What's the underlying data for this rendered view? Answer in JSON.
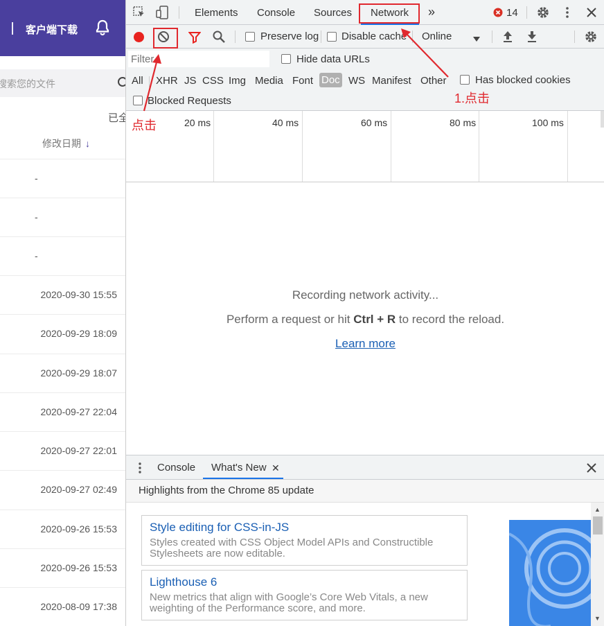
{
  "left_page": {
    "download_label": "客户端下载",
    "search_placeholder": "搜索您的文件",
    "already_label": "已全",
    "column_header": "修改日期",
    "sort_icon": "arrow-down-icon",
    "rows": [
      "-",
      "-",
      "-",
      "2020-09-30 15:55",
      "2020-09-29 18:09",
      "2020-09-29 18:07",
      "2020-09-27 22:04",
      "2020-09-27 22:01",
      "2020-09-27 02:49",
      "2020-09-26 15:53",
      "2020-09-26 15:53",
      "2020-08-09 17:38"
    ],
    "colors": {
      "header_bg": "#4a3f9e"
    }
  },
  "devtools": {
    "tabs": [
      "Elements",
      "Console",
      "Sources",
      "Network"
    ],
    "more_tabs": "»",
    "error_count": "14",
    "toolbar": {
      "preserve_log": "Preserve log",
      "disable_cache": "Disable cache",
      "throttling": "Online"
    },
    "filter": {
      "placeholder": "Filter",
      "hide_data_urls": "Hide data URLs",
      "types": [
        "All",
        "XHR",
        "JS",
        "CSS",
        "Img",
        "Media",
        "Font",
        "Doc",
        "WS",
        "Manifest",
        "Other"
      ],
      "active_type": "Doc",
      "has_blocked_cookies": "Has blocked cookies",
      "blocked_requests": "Blocked Requests"
    },
    "timeline_ticks": [
      "20 ms",
      "40 ms",
      "60 ms",
      "80 ms",
      "100 ms"
    ],
    "empty_state": {
      "line1": "Recording network activity...",
      "line2_before": "Perform a request or hit ",
      "line2_keys": "Ctrl + R",
      "line2_after": " to record the reload.",
      "learn_more": "Learn more"
    },
    "drawer": {
      "tabs": [
        "Console",
        "What's New"
      ],
      "heading": "Highlights from the Chrome 85 update",
      "cards": [
        {
          "title": "Style editing for CSS-in-JS",
          "desc": "Styles created with CSS Object Model APIs and Constructible Stylesheets are now editable."
        },
        {
          "title": "Lighthouse 6",
          "desc": "New metrics that align with Google’s Core Web Vitals, a new weighting of the Performance score, and more."
        }
      ]
    }
  },
  "annotations": {
    "step1": "1.点击",
    "click": "点击",
    "color": "#e0282e"
  }
}
